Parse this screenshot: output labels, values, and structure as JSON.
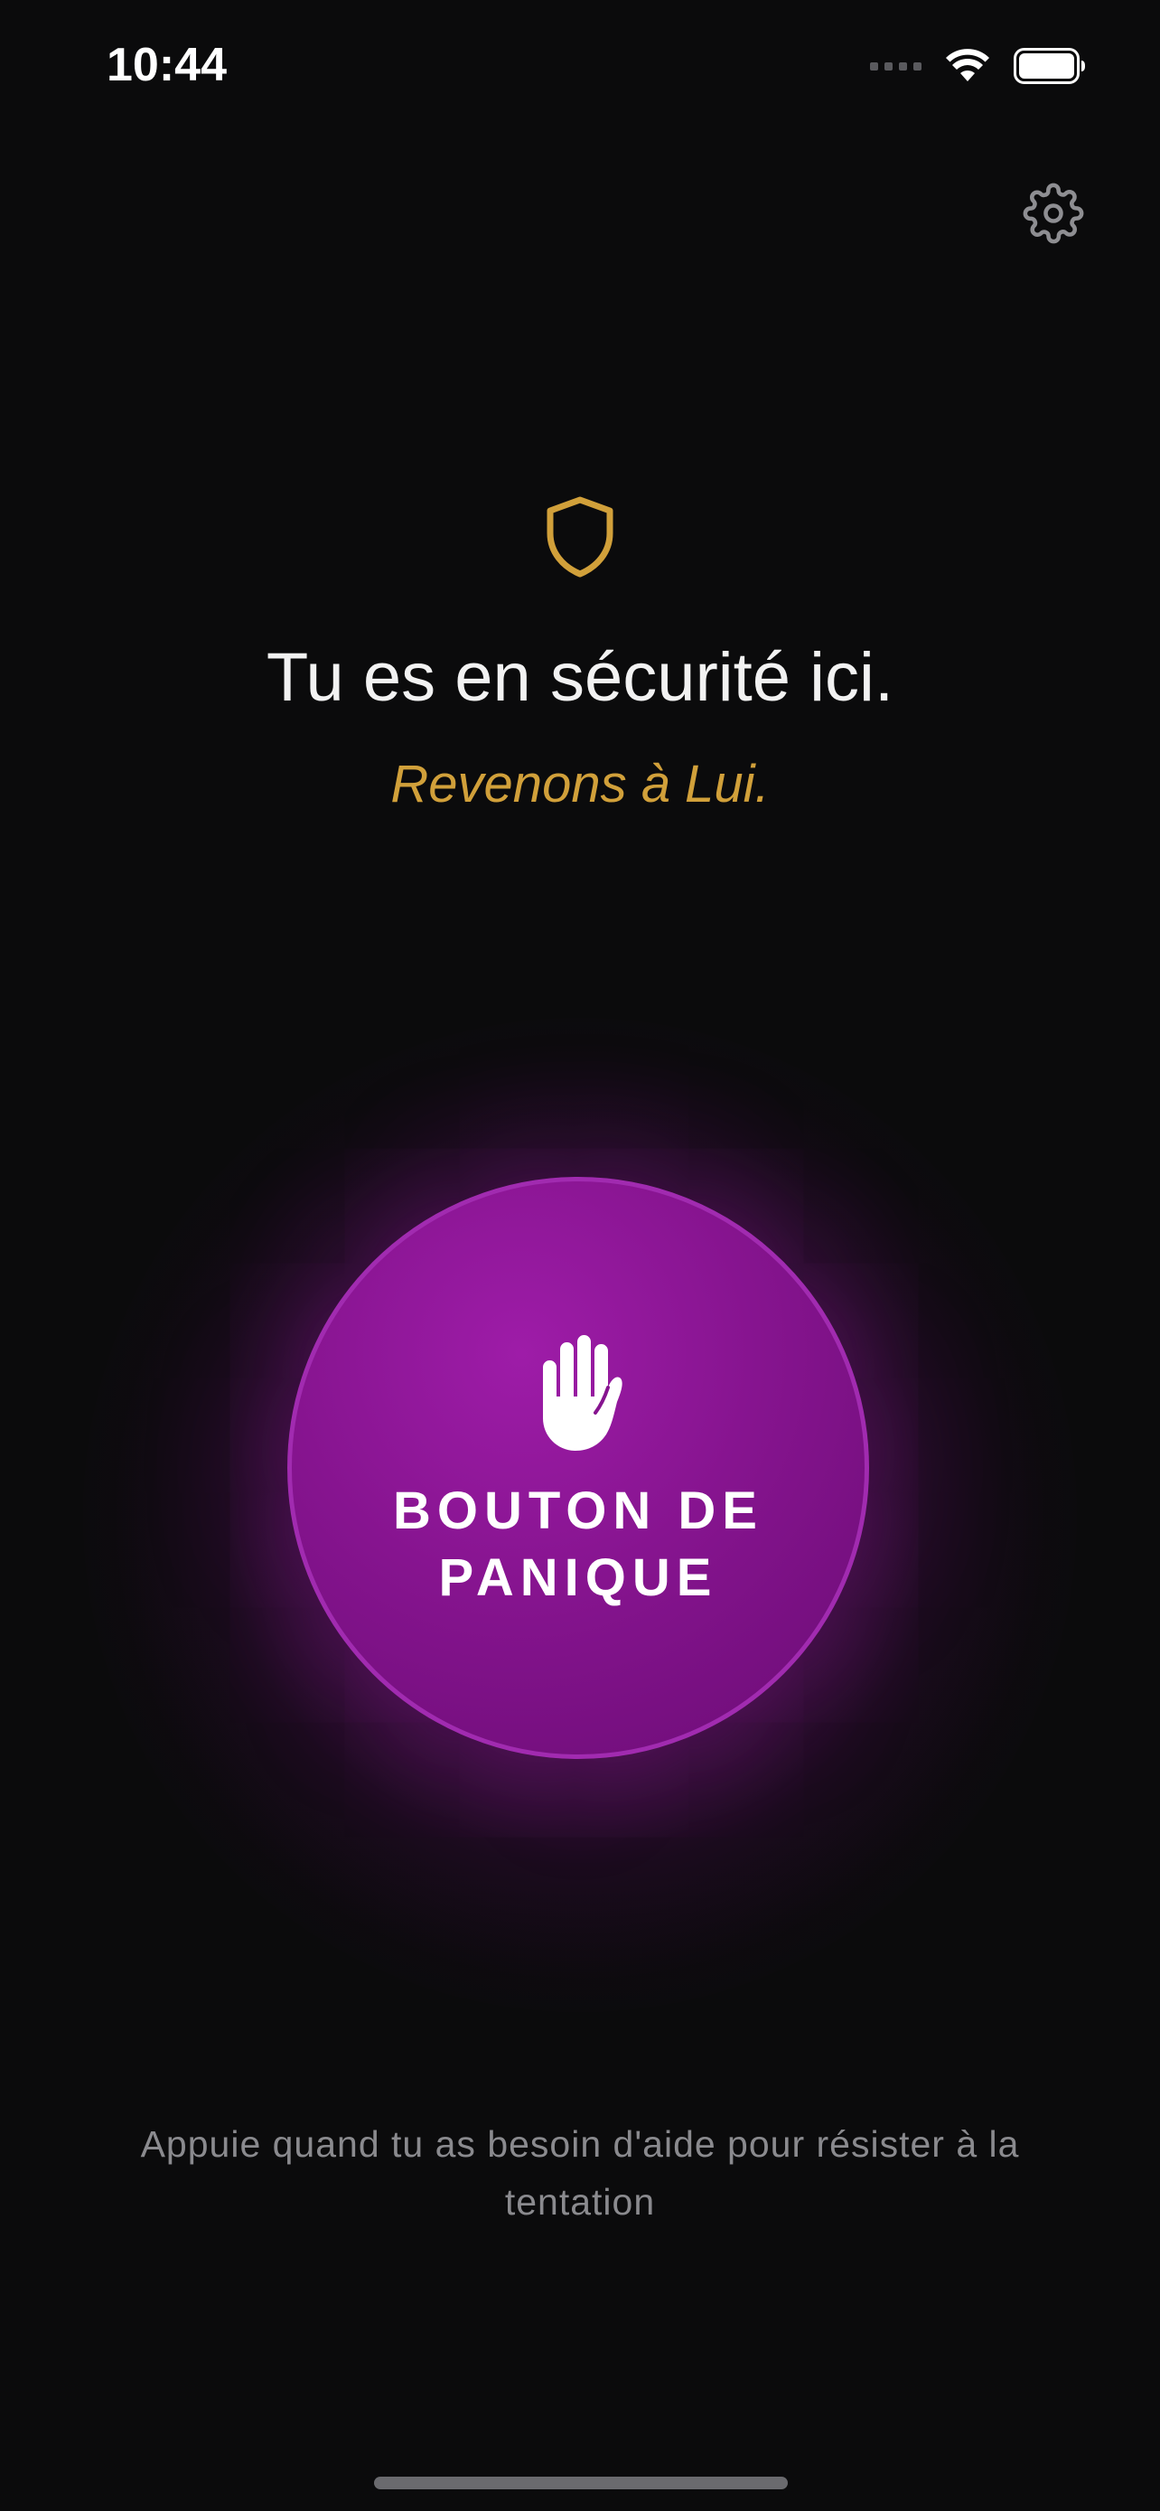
{
  "status_bar": {
    "time": "10:44"
  },
  "header": {
    "settings_icon": "gear-icon",
    "shield_icon": "shield-icon",
    "title": "Tu es en sécurité ici.",
    "subtitle": "Revenons à Lui."
  },
  "panic": {
    "icon": "raised-hand-icon",
    "label": "BOUTON DE\nPANIQUE"
  },
  "footer": {
    "hint": "Appuie quand tu as besoin d'aide pour résister à la tentation"
  },
  "colors": {
    "background": "#0b0b0c",
    "accent_gold": "#d1a03a",
    "panic_purple": "#86148f",
    "hint_gray": "#8a8a8e"
  }
}
